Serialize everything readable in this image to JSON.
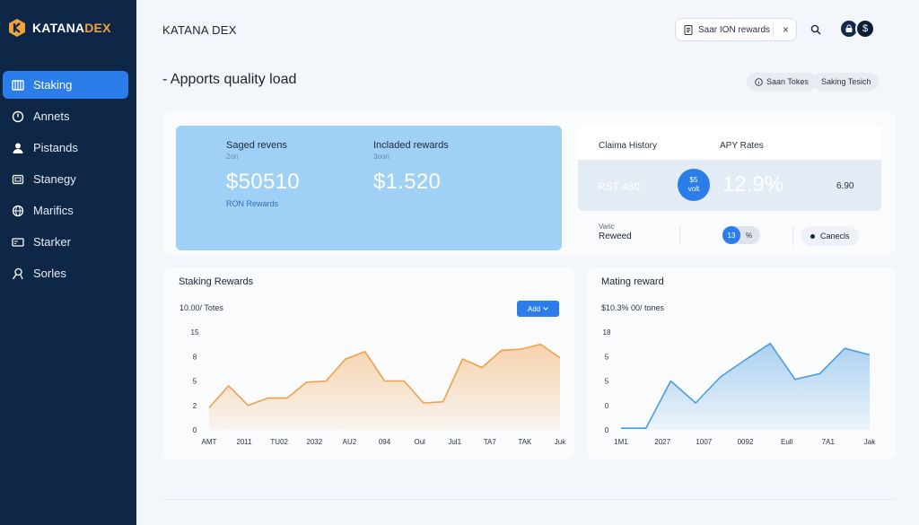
{
  "brand": {
    "name_main": "KATANA",
    "name_accent": "DEX",
    "accent_color": "#f2a23a"
  },
  "sidebar": {
    "items": [
      {
        "label": "Staking",
        "icon": "staking-icon",
        "active": true
      },
      {
        "label": "Annets",
        "icon": "clock-icon",
        "active": false
      },
      {
        "label": "Pistands",
        "icon": "user-icon",
        "active": false
      },
      {
        "label": "Stanegy",
        "icon": "wallet-icon",
        "active": false
      },
      {
        "label": "Marifics",
        "icon": "globe-icon",
        "active": false
      },
      {
        "label": "Starker",
        "icon": "card-icon",
        "active": false
      },
      {
        "label": "Sorles",
        "icon": "search-person-icon",
        "active": false
      }
    ]
  },
  "header": {
    "title": "KATANA DEX",
    "search_value": "Saar ION rewards",
    "clear_label": "×"
  },
  "avatars": [
    "",
    "$"
  ],
  "page": {
    "title": "- Apports quality load",
    "chips": [
      "Saan Tokes",
      "Saking Tesich"
    ]
  },
  "summary": {
    "stat1": {
      "label": "Saged revens",
      "sub": "2on",
      "value": "$50510"
    },
    "stat2": {
      "label": "Incladed rewards",
      "sub": "3oon",
      "value": "$1.520"
    },
    "link": "RON Rewards"
  },
  "right_card": {
    "tab1": "Claima History",
    "tab2": "APY Rates",
    "faded": "RST 480",
    "badge_line1": "$5",
    "badge_line2": "volt",
    "big_value": "12.9%",
    "right_value": "6.90",
    "row_label": "Varic",
    "row_value": "Reweed",
    "toggle_value": "13",
    "toggle_pct": "%",
    "cancel_label": "Canecls"
  },
  "charts": {
    "left": {
      "title": "Staking Rewards",
      "subtitle": "10.00/ Totes",
      "button_label": "Add"
    },
    "right": {
      "title": "Mating reward",
      "subtitle": "$10.3% 00/ tones"
    }
  },
  "chart_data": [
    {
      "type": "area",
      "title": "Staking Rewards",
      "color": "#f0a04b",
      "y_ticks": [
        "15",
        "8",
        "5",
        "2",
        "0"
      ],
      "x_ticks": [
        "AMT",
        "2011",
        "TU02",
        "2032",
        "AU2",
        "094",
        "Oul",
        "Jul1",
        "TA7",
        "TAK",
        "Juk"
      ],
      "values": [
        1.8,
        3.6,
        2.0,
        2.6,
        2.6,
        3.9,
        4.0,
        5.8,
        6.4,
        4.0,
        4.0,
        2.2,
        2.3,
        5.8,
        5.1,
        6.5,
        6.6,
        7.0,
        5.9
      ]
    },
    {
      "type": "area",
      "title": "Mating reward",
      "color": "#4a9de0",
      "y_ticks": [
        "18",
        "5",
        "5",
        "0",
        "0"
      ],
      "x_ticks": [
        "1M1",
        "2027",
        "1007",
        "0092",
        "Eull",
        "7A1",
        "Jak"
      ],
      "values": [
        0.2,
        0.2,
        6.0,
        3.3,
        6.5,
        8.6,
        10.6,
        6.2,
        6.9,
        10.0,
        9.2
      ]
    }
  ]
}
